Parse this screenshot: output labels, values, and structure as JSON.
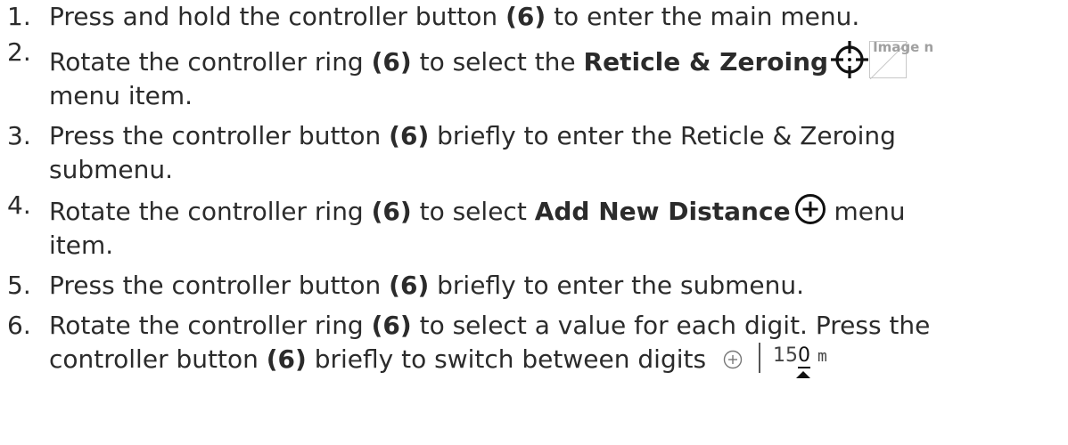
{
  "steps": [
    {
      "num": "1.",
      "t1": "Press and hold the controller button ",
      "b1": "(6)",
      "t2": " to enter the main menu."
    },
    {
      "num": "2.",
      "t1": "Rotate the controller ring ",
      "b1": "(6)",
      "t2": " to select the ",
      "b2": "Reticle & Zeroing",
      "icon": "reticle-icon",
      "img_alt": "Image n",
      "line2": "menu item."
    },
    {
      "num": "3.",
      "t1": "Press the controller button ",
      "b1": "(6)",
      "t2": " briefly to enter the Reticle & Zeroing",
      "line2": "submenu."
    },
    {
      "num": "4.",
      "t1": "Rotate the controller ring ",
      "b1": "(6)",
      "t2": " to select ",
      "b2": "Add New Distance",
      "icon": "plus-circle-icon",
      "t3": " menu",
      "line2": "item."
    },
    {
      "num": "5.",
      "t1": "Press the controller button ",
      "b1": "(6)",
      "t2": " briefly to enter the submenu."
    },
    {
      "num": "6.",
      "t1": "Rotate the controller ring ",
      "b1": "(6)",
      "t2": " to select a value for each digit. Press the",
      "l2a": "controller button ",
      "l2b": "(6)",
      "l2c": " briefly to switch between digits ",
      "mini_ui": {
        "icon": "plus-circle-icon",
        "digits_prefix": "15",
        "digit_active": "0",
        "unit": "m"
      }
    }
  ],
  "colors": {
    "text": "#2b2b2b",
    "alt_text": "#a0a0a0"
  }
}
